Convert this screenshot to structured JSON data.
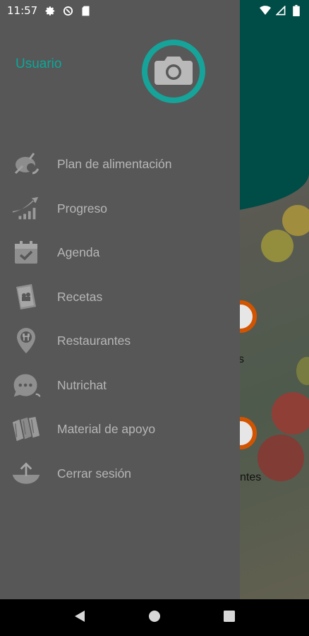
{
  "status_bar": {
    "time": "11:57",
    "left_icons": [
      "settings-icon",
      "sync-icon",
      "sd-card-icon"
    ],
    "right_icons": [
      "wifi-icon",
      "signal-icon",
      "battery-icon"
    ]
  },
  "drawer": {
    "user_label": "Usuario",
    "avatar_icon": "camera-icon",
    "menu": [
      {
        "label": "Plan de alimentación",
        "icon": "meal-plan-icon"
      },
      {
        "label": "Progreso",
        "icon": "progress-chart-icon"
      },
      {
        "label": "Agenda",
        "icon": "calendar-check-icon"
      },
      {
        "label": "Recetas",
        "icon": "recipe-book-icon"
      },
      {
        "label": "Restaurantes",
        "icon": "restaurant-pin-icon"
      },
      {
        "label": "Nutrichat",
        "icon": "chat-bubble-icon"
      },
      {
        "label": "Material de apoyo",
        "icon": "books-icon"
      },
      {
        "label": "Cerrar sesión",
        "icon": "logout-icon"
      }
    ]
  },
  "background_app": {
    "partial_text": "ntes",
    "partial_text_2": "s"
  },
  "nav_bar": {
    "buttons": [
      "back-icon",
      "home-icon",
      "recents-icon"
    ]
  },
  "colors": {
    "drawer_bg": "#575757",
    "accent": "#0aa89a",
    "header_bg": "#004c46",
    "menu_text": "#b6b6b6"
  }
}
